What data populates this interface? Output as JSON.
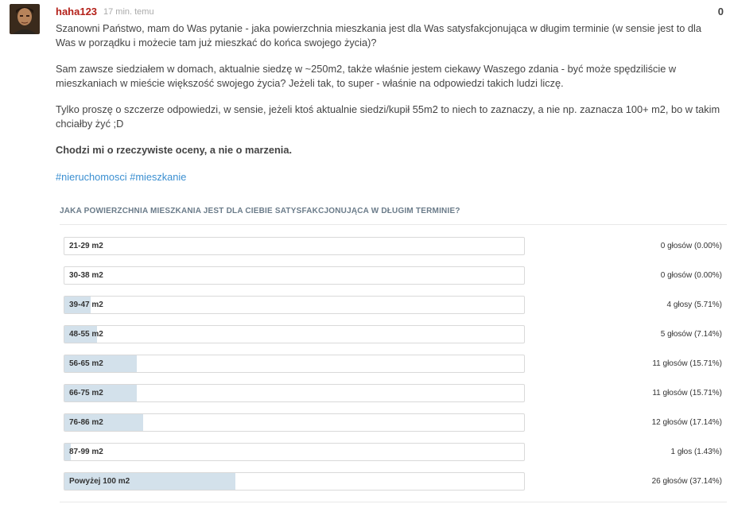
{
  "post": {
    "author": "haha123",
    "time": "17 min. temu",
    "score": "0",
    "paragraphs": [
      "Szanowni Państwo, mam do Was pytanie - jaka powierzchnia mieszkania jest dla Was satysfakcjonująca w długim terminie (w sensie jest to dla Was w porządku i możecie tam już mieszkać do końca swojego życia)?",
      "Sam zawsze siedziałem w domach, aktualnie siedzę w ~250m2, także właśnie jestem ciekawy Waszego zdania - być może spędziliście w mieszkaniach w mieście większość swojego życia? Jeżeli tak, to super - właśnie na odpowiedzi takich ludzi liczę.",
      "Tylko proszę o szczerze odpowiedzi, w sensie, jeżeli ktoś aktualnie siedzi/kupił 55m2 to niech to zaznaczy, a nie np. zaznacza 100+ m2, bo w takim chciałby żyć ;D",
      "Chodzi mi o rzeczywiste oceny, a nie o marzenia."
    ],
    "tags": [
      "nieruchomosci",
      "mieszkanie"
    ]
  },
  "poll": {
    "title": "JAKA POWIERZCHNIA MIESZKANIA JEST DLA CIEBIE SATYSFAKCJONUJĄCA W DŁUGIM TERMINIE?",
    "options": [
      {
        "label": "21-29 m2",
        "count": "0 głosów (0.00%)",
        "percent": 0.0
      },
      {
        "label": "30-38 m2",
        "count": "0 głosów (0.00%)",
        "percent": 0.0
      },
      {
        "label": "39-47 m2",
        "count": "4 głosy (5.71%)",
        "percent": 5.71
      },
      {
        "label": "48-55 m2",
        "count": "5 głosów (7.14%)",
        "percent": 7.14
      },
      {
        "label": "56-65 m2",
        "count": "11 głosów (15.71%)",
        "percent": 15.71
      },
      {
        "label": "66-75 m2",
        "count": "11 głosów (15.71%)",
        "percent": 15.71
      },
      {
        "label": "76-86 m2",
        "count": "12 głosów (17.14%)",
        "percent": 17.14
      },
      {
        "label": "87-99 m2",
        "count": "1 głos (1.43%)",
        "percent": 1.43
      },
      {
        "label": "Powyżej 100 m2",
        "count": "26 głosów (37.14%)",
        "percent": 37.14
      }
    ]
  }
}
